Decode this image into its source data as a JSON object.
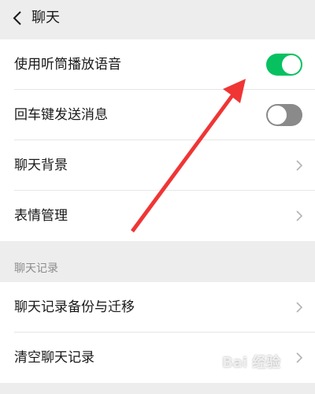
{
  "header": {
    "title": "聊天",
    "back_icon": "chevron-left-icon"
  },
  "settings": {
    "voice_earpiece": {
      "label": "使用听筒播放语音",
      "enabled": true
    },
    "enter_send": {
      "label": "回车键发送消息",
      "enabled": false
    },
    "chat_background": {
      "label": "聊天背景"
    },
    "emoji_manage": {
      "label": "表情管理"
    }
  },
  "section": {
    "chat_history_label": "聊天记录"
  },
  "history": {
    "backup_migrate": {
      "label": "聊天记录备份与迁移"
    },
    "clear": {
      "label": "清空聊天记录"
    }
  },
  "colors": {
    "toggle_on": "#07c160",
    "toggle_off": "#8a8a8a",
    "annotation_arrow": "#f03535",
    "background": "#ededed"
  },
  "watermark": {
    "text": "Bai 经验"
  }
}
